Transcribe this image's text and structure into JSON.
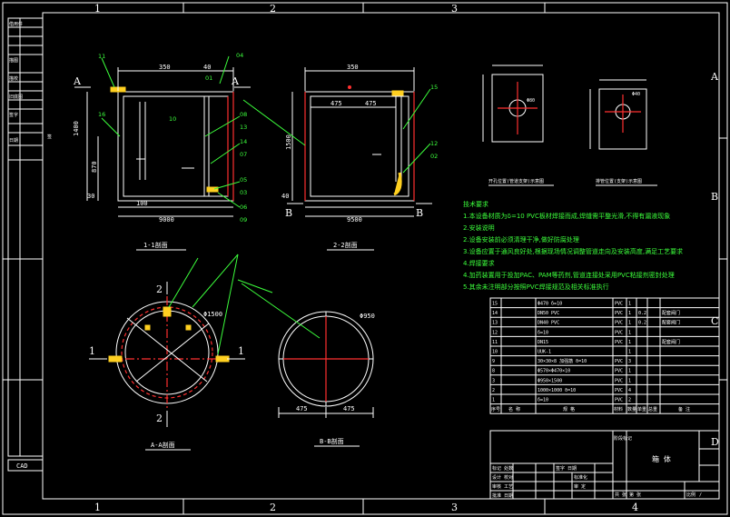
{
  "frame": {
    "zones_top": [
      "1",
      "2",
      "3"
    ],
    "zones_bottom": [
      "1",
      "2",
      "3",
      "4"
    ],
    "zones_right": [
      "A",
      "B",
      "C",
      "D"
    ],
    "cad_label": "CAD"
  },
  "views": {
    "section_11": {
      "title": "1-1剖面",
      "dims": {
        "top": "350",
        "top_small": "40",
        "height_left": "1400",
        "mid": "870",
        "bottom": "100",
        "base": "9000",
        "inner": "30"
      },
      "marks": {
        "left": "A",
        "right": "A"
      }
    },
    "section_22": {
      "title": "2-2剖面",
      "dims": {
        "top": "350",
        "left_w": "475",
        "right_w": "475",
        "height": "1500",
        "base": "9500",
        "inner": "40"
      },
      "marks": {
        "left": "B",
        "right": "B"
      }
    },
    "section_aa": {
      "title": "A-A剖面",
      "marks": {
        "top": "2",
        "bottom": "2",
        "left": "1",
        "right": "1"
      },
      "dim": "Φ1500"
    },
    "section_bb": {
      "title": "B-B剖面",
      "dims": {
        "diameter": "Φ950",
        "left": "475",
        "right": "475"
      }
    },
    "detail_left": {
      "caption": "开孔位置(管道支架)示意图",
      "dim": "Φ80"
    },
    "detail_right": {
      "caption": "排管位置(支架)示意图",
      "dim": "Φ40"
    }
  },
  "callouts": [
    "11",
    "04",
    "01",
    "10",
    "08",
    "13",
    "14",
    "07",
    "05",
    "03",
    "06",
    "09",
    "16",
    "15",
    "12",
    "02"
  ],
  "notes": {
    "heading": "技术要求",
    "lines": [
      "1.本设备材质为δ=10 PVC板材焊接而成,焊缝需平整光滑,不得有漏液现象",
      "2.安装说明",
      "2.设备安装前必须清理干净,做好防腐处理",
      "3.设备应置于通风良好处,根据现场情况调整管道走向及安装高度,满足工艺要求",
      "4.焊接要求",
      "4.加药装置用于投加PAC、PAM等药剂,管道连接处采用PVC粘接剂密封处理",
      "5.其余未注明部分按照PVC焊接规范及相关标准执行"
    ]
  },
  "bom": {
    "rows": [
      {
        "no": "15",
        "name": "",
        "spec": "Φ470 δ=10",
        "mat": "PVC",
        "qty": "1",
        "w": "",
        "note": ""
      },
      {
        "no": "14",
        "name": "",
        "spec": "DN50 PVC",
        "mat": "PVC",
        "qty": "1",
        "w": "0.2",
        "note": "配套阀门"
      },
      {
        "no": "13",
        "name": "",
        "spec": "DN40 PVC",
        "mat": "PVC",
        "qty": "1",
        "w": "0.2",
        "note": "配套阀门"
      },
      {
        "no": "12",
        "name": "",
        "spec": "δ=10",
        "mat": "PVC",
        "qty": "1",
        "w": "",
        "note": ""
      },
      {
        "no": "11",
        "name": "",
        "spec": "DN15",
        "mat": "PVC",
        "qty": "1",
        "w": "",
        "note": "配套阀门"
      },
      {
        "no": "10",
        "name": "",
        "spec": "UUK-1",
        "mat": "",
        "qty": "1",
        "w": "",
        "note": ""
      },
      {
        "no": "9",
        "name": "",
        "spec": "30×30×8 加强筋 δ=10",
        "mat": "PVC",
        "qty": "3",
        "w": "",
        "note": ""
      },
      {
        "no": "8",
        "name": "",
        "spec": "Φ570×Φ470×10",
        "mat": "PVC",
        "qty": "1",
        "w": "",
        "note": ""
      },
      {
        "no": "3",
        "name": "",
        "spec": "Φ950×1500",
        "mat": "PVC",
        "qty": "1",
        "w": "",
        "note": ""
      },
      {
        "no": "2",
        "name": "",
        "spec": "1000×1000 δ=10",
        "mat": "PVC",
        "qty": "4",
        "w": "",
        "note": ""
      },
      {
        "no": "1",
        "name": "",
        "spec": "δ=10",
        "mat": "PVC",
        "qty": "2",
        "w": "",
        "note": ""
      }
    ],
    "header": {
      "no": "序号",
      "name": "名 称",
      "spec": "规 格",
      "mat": "材料",
      "qty": "数量",
      "w1": "单重",
      "w2": "总重",
      "w_unit": "重量(kg)",
      "note": "备 注"
    }
  },
  "title_block": {
    "drawing_title": "箱 体",
    "left_rows": [
      "标记 处数",
      "设计 校对",
      "审核 工艺",
      "批准 日期"
    ],
    "mid_labels": [
      "签字 日期",
      "标准化",
      "审 定"
    ],
    "stage": "阶段标记",
    "sheet": "共 张 第 张",
    "scale": "比例",
    "page": "/"
  },
  "side_table": {
    "left_rows": [
      "借用件",
      "描图",
      "描校",
      "旧底图",
      "签字",
      "日期"
    ],
    "mark": "签"
  }
}
